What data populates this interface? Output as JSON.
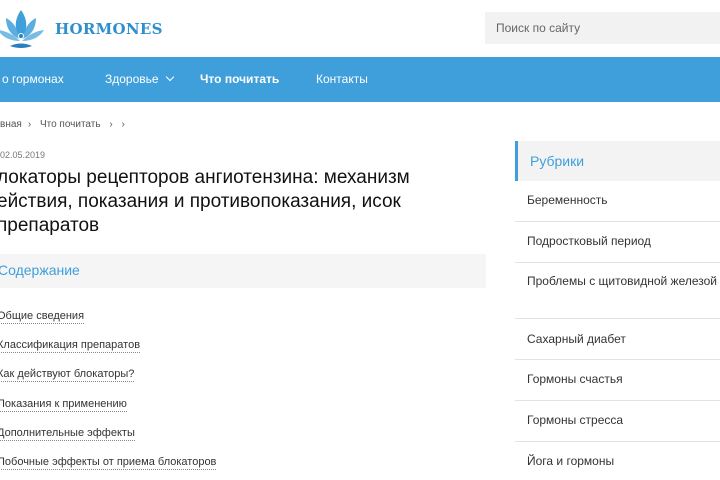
{
  "header": {
    "brand": "HORMONES",
    "search_placeholder": "Поиск по сайту"
  },
  "nav": {
    "items": [
      {
        "label": "о гормонах"
      },
      {
        "label": "Здоровье"
      },
      {
        "label": "Что почитать"
      },
      {
        "label": "Контакты"
      }
    ]
  },
  "breadcrumb": {
    "items": [
      "вная",
      "Что почитать",
      "›",
      "›"
    ]
  },
  "article": {
    "date": "02.05.2019",
    "title": "локаторы рецепторов ангиотензина: механизм ействия, показания и противопоказания, исок препаратов"
  },
  "toc": {
    "title": "Содержание",
    "items": [
      "Общие сведения",
      "Классификация препаратов",
      "Как действуют блокаторы?",
      "Показания к применению",
      "Дополнительные эффекты",
      "Побочные эффекты от приема блокаторов"
    ]
  },
  "sidebar": {
    "title": "Рубрики",
    "items": [
      "Беременность",
      "Подростковый период",
      "Проблемы с щитовидной железой",
      "Сахарный диабет",
      "Гормоны счастья",
      "Гормоны стресса",
      "Йога и гормоны"
    ]
  },
  "colors": {
    "accent": "#3f9fdb",
    "brand": "#2f8fce"
  }
}
